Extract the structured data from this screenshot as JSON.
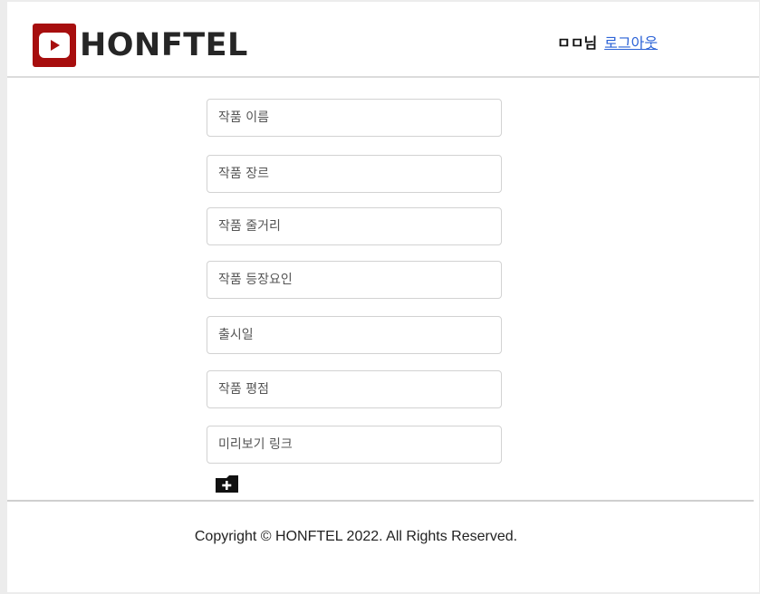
{
  "header": {
    "logo_text": "HONFTEL",
    "user_name": "ㅁㅁ님",
    "logout_label": "로그아웃"
  },
  "form": {
    "fields": [
      {
        "placeholder": "작품 이름"
      },
      {
        "placeholder": "작품 장르"
      },
      {
        "placeholder": "작품 줄거리"
      },
      {
        "placeholder": "작품 등장요인"
      },
      {
        "placeholder": "출시일"
      },
      {
        "placeholder": "작품 평점"
      },
      {
        "placeholder": "미리보기 링크"
      }
    ]
  },
  "footer": {
    "copyright": "Copyright © HONFTEL 2022. All Rights Reserved."
  }
}
